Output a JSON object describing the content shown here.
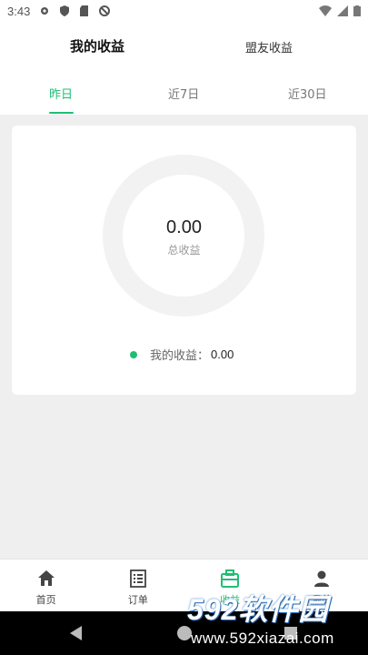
{
  "status_bar": {
    "time": "3:43"
  },
  "header": {
    "tab_mine": "我的收益",
    "tab_ally": "盟友收益"
  },
  "periods": [
    {
      "label": "昨日",
      "active": true
    },
    {
      "label": "近7日",
      "active": false
    },
    {
      "label": "近30日",
      "active": false
    }
  ],
  "summary": {
    "total_value": "0.00",
    "total_label": "总收益",
    "legend_label": "我的收益：",
    "legend_value": "0.00"
  },
  "colors": {
    "accent": "#1fbf73",
    "background": "#efefef"
  },
  "tabbar": [
    {
      "label": "首页",
      "icon": "home-icon"
    },
    {
      "label": "订单",
      "icon": "list-icon"
    },
    {
      "label": "收益",
      "icon": "briefcase-icon",
      "active": true
    },
    {
      "label": "我的",
      "icon": "person-icon"
    }
  ],
  "watermark": {
    "brand": "592软件园",
    "url": "www.592xiazai.com"
  }
}
